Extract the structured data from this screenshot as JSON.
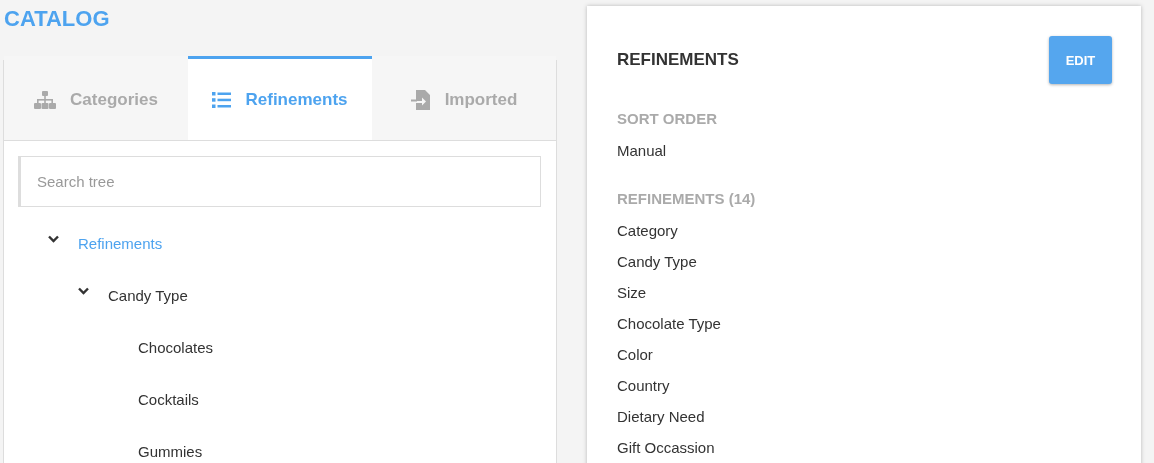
{
  "title": "CATALOG",
  "tabs": [
    {
      "label": "Categories",
      "selected": false
    },
    {
      "label": "Refinements",
      "selected": true
    },
    {
      "label": "Imported",
      "selected": false
    }
  ],
  "search": {
    "placeholder": "Search tree"
  },
  "tree": [
    {
      "label": "Refinements",
      "selected": true,
      "expanded": true,
      "children": [
        {
          "label": "Candy Type",
          "selected": false,
          "expanded": true,
          "children": [
            {
              "label": "Chocolates",
              "selected": false
            },
            {
              "label": "Cocktails",
              "selected": false
            },
            {
              "label": "Gummies",
              "selected": false
            }
          ]
        }
      ]
    }
  ],
  "details": {
    "title": "REFINEMENTS",
    "edit_button": "EDIT",
    "sections": [
      {
        "heading": "SORT ORDER",
        "items": [
          "Manual"
        ]
      },
      {
        "heading": "REFINEMENTS (14)",
        "items": [
          "Category",
          "Candy Type",
          "Size",
          "Chocolate Type",
          "Color",
          "Country",
          "Dietary Need",
          "Gift Occassion"
        ]
      }
    ]
  }
}
